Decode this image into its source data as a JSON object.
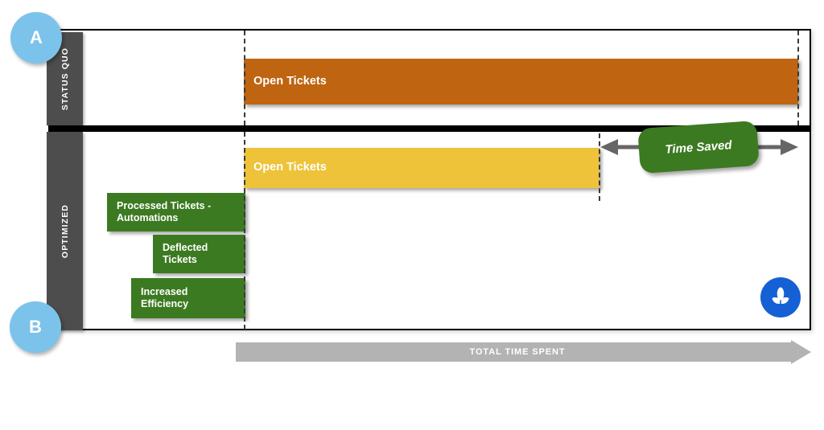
{
  "chart_data": {
    "type": "bar",
    "title": "",
    "orientation": "horizontal",
    "xlabel": "TOTAL TIME SPENT",
    "ylabel": "",
    "rows": [
      {
        "row_label": "STATUS QUO",
        "step_marker": "A",
        "bars": [
          {
            "label": "Open Tickets",
            "start": 0,
            "end": 100,
            "color": "#bf6411"
          }
        ]
      },
      {
        "row_label": "OPTIMIZED",
        "step_marker": "B",
        "bars": [
          {
            "label": "Open Tickets",
            "start": 0,
            "end": 64,
            "color": "#eec33a"
          },
          {
            "label": "Processed Tickets - Automations",
            "start": -25,
            "end": 0,
            "color": "#3c7a21"
          },
          {
            "label": "Deflected Tickets",
            "start": -17,
            "end": 0,
            "color": "#3c7a21"
          },
          {
            "label": "Increased Efficiency",
            "start": -21,
            "end": 0,
            "color": "#3c7a21"
          }
        ]
      }
    ],
    "annotations": [
      {
        "text": "Time Saved",
        "type": "double-arrow-badge",
        "from": 64,
        "to": 100
      }
    ],
    "axis_markers": [
      "start-baseline",
      "optimized-end",
      "status-quo-end"
    ],
    "grid": false,
    "legend": null
  },
  "steps": {
    "a": "A",
    "b": "B"
  },
  "rows": {
    "status_quo": {
      "label": "STATUS QUO"
    },
    "optimized": {
      "label": "OPTIMIZED"
    }
  },
  "bars": {
    "open_tickets_status": "Open Tickets",
    "open_tickets_optimized": "Open Tickets",
    "processed_tickets": "Processed Tickets -\nAutomations",
    "deflected_tickets": "Deflected\nTickets",
    "increased_efficiency": "Increased\nEfficiency"
  },
  "annotations": {
    "time_saved": "Time Saved",
    "total_time_spent": "TOTAL TIME SPENT"
  },
  "colors": {
    "status_quo_bar": "#bf6411",
    "optimized_bar": "#eec33a",
    "gain_bar": "#3c7a21",
    "side_label": "#4d4d4d",
    "step_circle": "#7cc3eb",
    "total_arrow": "#b3b3b3",
    "brand": "#1560d4"
  },
  "brand": {
    "icon": "plant-leaf-icon"
  }
}
